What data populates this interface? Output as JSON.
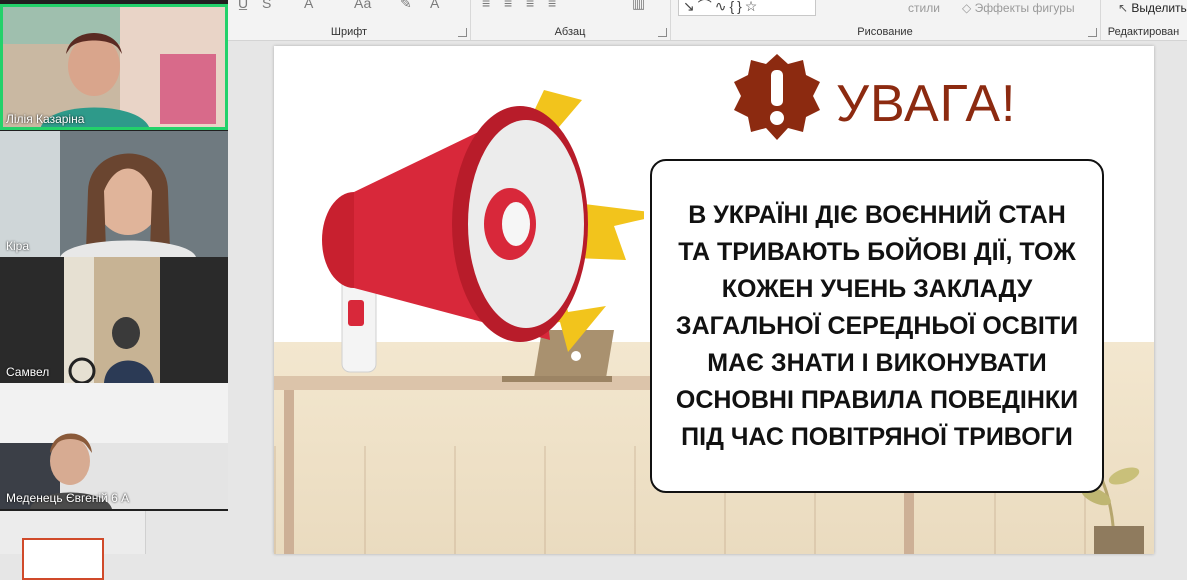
{
  "ribbon": {
    "groups": {
      "font": "Шрифт",
      "paragraph": "Абзац",
      "drawing": "Рисование",
      "editing": "Редактирован"
    },
    "styles_label": "стили",
    "shape_effects": "Эффекты фигуры",
    "select_button": "Выделить"
  },
  "participants": [
    {
      "name": "Лілія Казаріна",
      "active": true
    },
    {
      "name": "Кіра",
      "active": false
    },
    {
      "name": "Самвел",
      "active": false
    },
    {
      "name": "Меденець Євгеній 6 А",
      "active": false
    }
  ],
  "slide": {
    "title": "УВАГА!",
    "message": "В Україні діє воєнний стан та тривають бойові дії, тож кожен учень закладу загальної середньої освіти має знати і виконувати основні правила поведінки під час повітряної тривоги"
  },
  "colors": {
    "accent_title": "#8c2a10",
    "active_speaker": "#23d16a",
    "megaphone_red": "#d8283a",
    "lightning": "#f2c41c"
  }
}
